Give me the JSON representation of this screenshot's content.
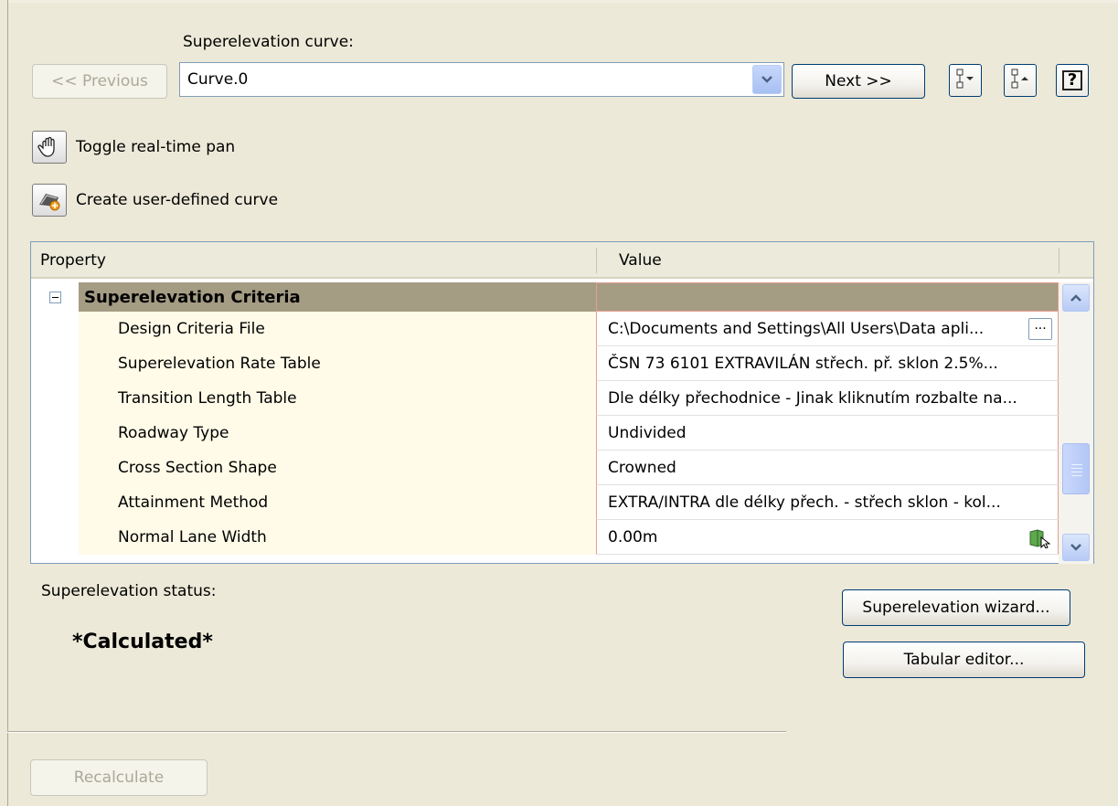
{
  "header": {
    "curve_label": "Superelevation curve:",
    "curve_value": "Curve.0",
    "previous_label": "<< Previous",
    "next_label": "Next >>",
    "help_label": "?"
  },
  "tools": {
    "pan_label": "Toggle real-time pan",
    "create_curve_label": "Create user-defined curve"
  },
  "grid": {
    "columns": [
      "Property",
      "Value"
    ],
    "group": "Superelevation Criteria",
    "rows": [
      {
        "property": "Design Criteria File",
        "value": "C:\\Documents and Settings\\All Users\\Data apli..."
      },
      {
        "property": "Superelevation Rate Table",
        "value": "ČSN 73 6101 EXTRAVILÁN střech. př. sklon 2.5%..."
      },
      {
        "property": "Transition Length Table",
        "value": "Dle délky přechodnice - Jinak kliknutím rozbalte na..."
      },
      {
        "property": "Roadway Type",
        "value": "Undivided"
      },
      {
        "property": "Cross Section Shape",
        "value": "Crowned"
      },
      {
        "property": "Attainment Method",
        "value": "EXTRA/INTRA dle délky přech. - střech sklon - kol..."
      },
      {
        "property": "Normal Lane Width",
        "value": "0.00m"
      }
    ]
  },
  "status": {
    "label": "Superelevation status:",
    "value": "*Calculated*"
  },
  "actions": {
    "wizard_label": "Superelevation wizard...",
    "tabular_label": "Tabular editor...",
    "recalculate_label": "Recalculate"
  }
}
